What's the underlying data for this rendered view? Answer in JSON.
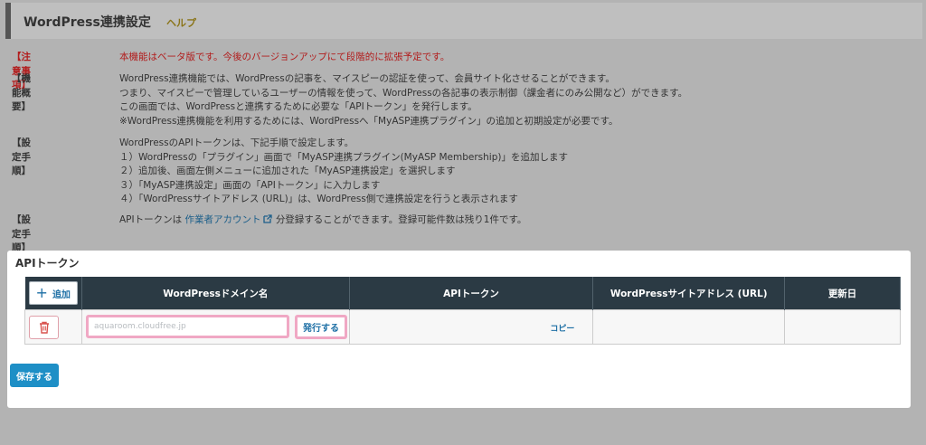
{
  "header": {
    "title": "WordPress連携設定",
    "help": "ヘルプ"
  },
  "notes": {
    "caution_label": "【注意事項】",
    "caution_text": "本機能はベータ版です。今後のバージョンアップにて段階的に拡張予定です。",
    "overview_label": "【機能概要】",
    "overview_lines": [
      "WordPress連携機能では、WordPressの記事を、マイスピーの認証を使って、会員サイト化させることができます。",
      "つまり、マイスピーで管理しているユーザーの情報を使って、WordPressの各記事の表示制御（課金者にのみ公開など）ができます。",
      "この画面では、WordPressと連携するために必要な「APIトークン」を発行します。",
      "※WordPress連携機能を利用するためには、WordPressへ「MyASP連携プラグイン」の追加と初期設定が必要です。"
    ],
    "steps_label": "【設定手順】",
    "steps_lines": [
      "WordPressのAPIトークンは、下記手順で設定します。",
      "１）WordPressの「プラグイン」画面で「MyASP連携プラグイン(MyASP Membership)」を追加します",
      "２）追加後、画面左側メニューに追加された「MyASP連携設定」を選択します",
      "３）「MyASP連携設定」画面の「APIトークン」に入力します",
      "４）「WordPressサイトアドレス (URL)」は、WordPress側で連携設定を行うと表示されます"
    ],
    "steps2_label": "【設定手順】",
    "steps2_pre": "APIトークンは",
    "steps2_link": "作業者アカウント",
    "steps2_post": "分登録することができます。登録可能件数は残り1件です。"
  },
  "card": {
    "title": "APIトークン",
    "add_label": "追加",
    "columns": [
      "WordPressドメイン名",
      "APIトークン",
      "WordPressサイトアドレス (URL)",
      "更新日"
    ],
    "row": {
      "domain_value": "aquaroom.cloudfree.jp",
      "issue_label": "発行する",
      "copy_label": "コピー"
    },
    "save_label": "保存する"
  },
  "colors": {
    "header_bg": "#2b3a44",
    "accent_blue": "#1e8fc6",
    "caution_red": "#b21c1c",
    "highlight_pink": "#f0a8c4"
  }
}
